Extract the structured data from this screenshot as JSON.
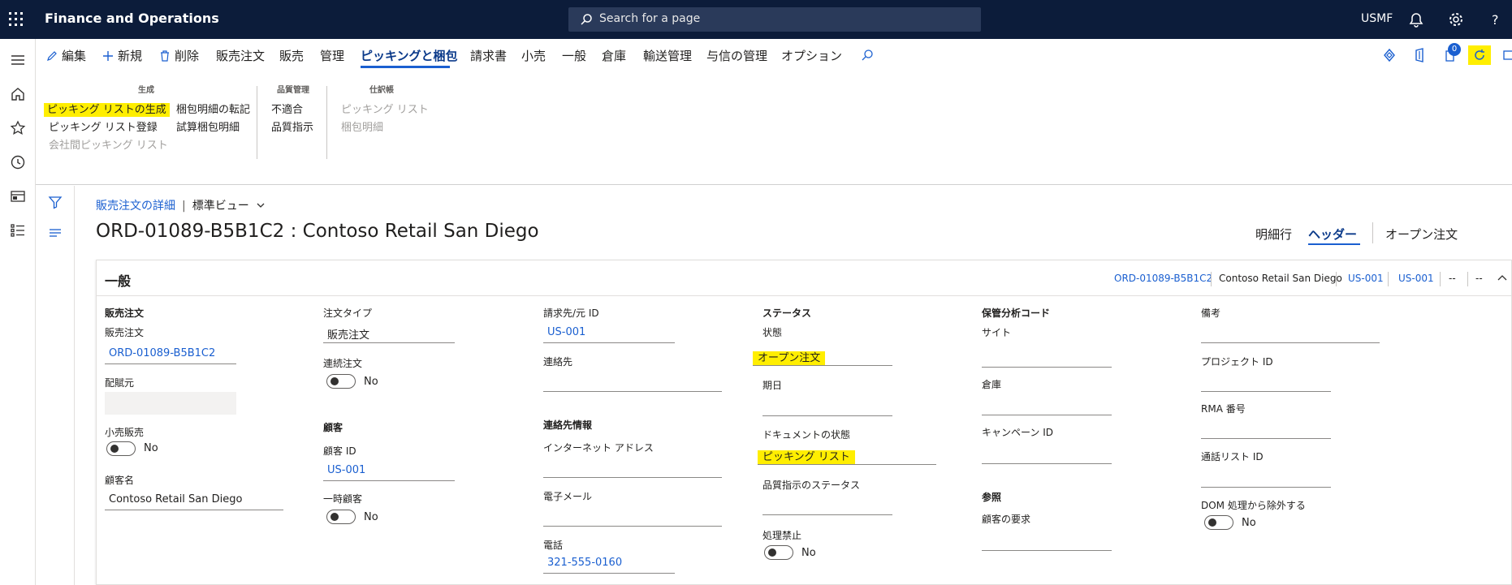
{
  "app": {
    "title": "Finance and Operations",
    "search_placeholder": "Search for a page",
    "company": "USMF"
  },
  "actionbar": {
    "edit": "編集",
    "new": "新規",
    "delete": "削除",
    "tabs": [
      "販売注文",
      "販売",
      "管理",
      "ピッキングと梱包",
      "請求書",
      "小売",
      "一般",
      "倉庫",
      "輸送管理",
      "与信の管理",
      "オプション"
    ],
    "selected_tab": "ピッキングと梱包",
    "badge": "0"
  },
  "ribbon": {
    "groups": [
      {
        "title": "生成",
        "items": [
          "ピッキング リストの生成",
          "ピッキング リスト登録",
          "会社間ピッキング リスト",
          "梱包明細の転記",
          "試算梱包明細"
        ]
      },
      {
        "title": "品質管理",
        "items": [
          "不適合",
          "品質指示"
        ]
      },
      {
        "title": "仕訳帳",
        "items": [
          "ピッキング リスト",
          "梱包明細"
        ]
      }
    ]
  },
  "breadcrumb": {
    "link": "販売注文の詳細",
    "view": "標準ビュー"
  },
  "page_title": "ORD-01089-B5B1C2 : Contoso Retail San Diego",
  "view_tabs": {
    "lines": "明細行",
    "header": "ヘッダー",
    "open_orders": "オープン注文"
  },
  "general": {
    "title": "一般",
    "summary": [
      "ORD-01089-B5B1C2",
      "Contoso Retail San Diego",
      "US-001",
      "US-001",
      "--",
      "--"
    ],
    "col1": {
      "group": "販売注文",
      "sales_order_label": "販売注文",
      "sales_order_value": "ORD-01089-B5B1C2",
      "allocation_label": "配賦元",
      "retail_label": "小売販売",
      "retail_value": "No",
      "customer_name_label": "顧客名",
      "customer_name_value": "Contoso Retail San Diego"
    },
    "col2": {
      "order_type_label": "注文タイプ",
      "order_type_value": "販売注文",
      "continuity_label": "連続注文",
      "continuity_value": "No",
      "group": "顧客",
      "customer_id_label": "顧客 ID",
      "customer_id_value": "US-001",
      "onetime_label": "一時顧客",
      "onetime_value": "No"
    },
    "col3": {
      "invoice_label": "請求先/元 ID",
      "invoice_value": "US-001",
      "contact_label": "連絡先",
      "group": "連絡先情報",
      "internet_label": "インターネット アドレス",
      "email_label": "電子メール",
      "phone_label": "電話",
      "phone_value": "321-555-0160"
    },
    "col4": {
      "group": "ステータス",
      "state_label": "状態",
      "state_value": "オープン注文",
      "due_label": "期日",
      "doc_status_label": "ドキュメントの状態",
      "doc_status_value": "ピッキング リスト",
      "quality_label": "品質指示のステータス",
      "hold_label": "処理禁止",
      "hold_value": "No"
    },
    "col5": {
      "group": "保管分析コード",
      "site_label": "サイト",
      "warehouse_label": "倉庫",
      "campaign_label": "キャンペーン ID",
      "group2": "参照",
      "request_label": "顧客の要求"
    },
    "col6": {
      "notes_label": "備考",
      "project_label": "プロジェクト ID",
      "rma_label": "RMA 番号",
      "call_list_label": "通話リスト ID",
      "dom_label": "DOM 処理から除外する",
      "dom_value": "No"
    }
  }
}
